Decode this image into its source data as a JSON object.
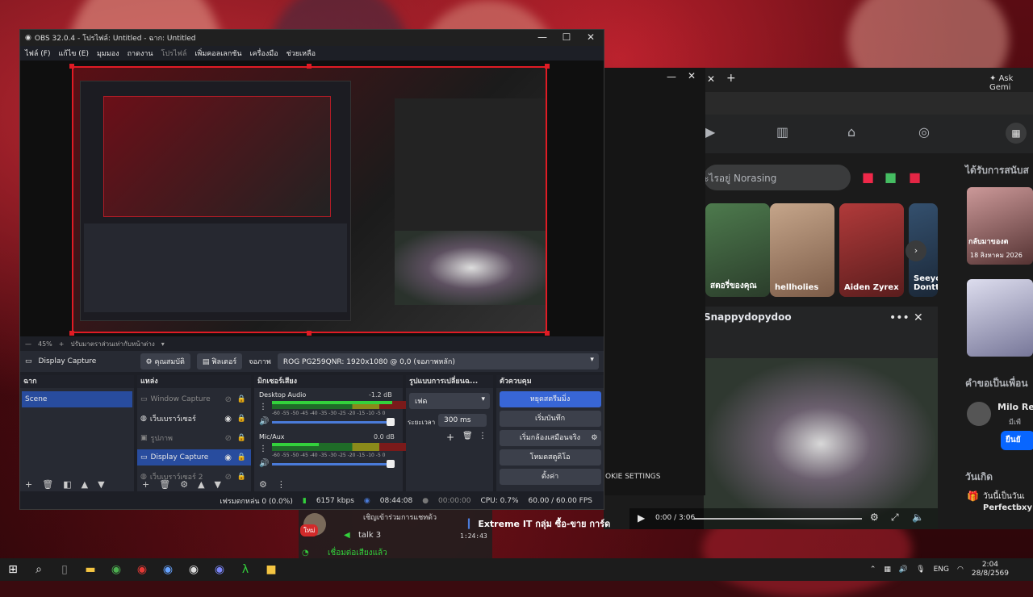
{
  "obs": {
    "title": "OBS 32.0.4 - โปรไฟล์: Untitled - ฉาก: Untitled",
    "menu": [
      "ไฟล์ (F)",
      "แก้ไข (E)",
      "มุมมอง",
      "ถาดงาน",
      "โปรไฟล์",
      "เพิ่มคอลเลกชัน",
      "เครื่องมือ",
      "ช่วยเหลือ"
    ],
    "zoom": "45%",
    "zoom_label": "ปรับมาตราส่วนเท่ากับหน้าต่าง",
    "source_name": "Display Capture",
    "properties_btn": "คุณสมบัติ",
    "filters_btn": "ฟิลเตอร์",
    "display_label": "จอภาพ",
    "display_value": "ROG PG259QNR: 1920x1080 @ 0,0 (จอภาพหลัก)",
    "scenes_header": "ฉาก",
    "scenes": [
      "Scene"
    ],
    "sources_header": "แหล่ง",
    "sources": [
      {
        "name": "Window Capture",
        "icon": "window-icon"
      },
      {
        "name": "เว็บเบราว์เซอร์",
        "icon": "globe-icon"
      },
      {
        "name": "รูปภาพ",
        "icon": "image-icon"
      },
      {
        "name": "Display Capture",
        "icon": "monitor-icon"
      },
      {
        "name": "เว็บเบราว์เซอร์ 2",
        "icon": "globe-icon"
      }
    ],
    "mixer_header": "มิกเซอร์เสียง",
    "mixer": [
      {
        "name": "Desktop Audio",
        "db": "-1.2 dB",
        "level": 0.9
      },
      {
        "name": "Mic/Aux",
        "db": "0.0 dB",
        "level": 0.35
      }
    ],
    "meter_ticks": "-60 -55 -50 -45 -40 -35 -30 -25 -20 -15 -10 -5 0",
    "transitions_header": "รูปแบบการเปลี่ยนฉ...",
    "transition_type": "เฟด",
    "duration_label": "ระยะเวลา",
    "duration_value": "300 ms",
    "controls_header": "ตัวควบคุม",
    "controls": [
      "หยุดสตรีมมิ่ง",
      "เริ่มบันทึก",
      "เริ่มกล้องเสมือนจริง",
      "โหมดสตูดิโอ",
      "ตั้งค่า"
    ],
    "status": {
      "dropped": "เฟรมตกหล่น 0 (0.0%)",
      "bitrate": "6157 kbps",
      "stream_time": "08:44:08",
      "rec_time": "00:00:00",
      "cpu": "CPU: 0.7%",
      "fps": "60.00 / 60.00 FPS"
    }
  },
  "browser": {
    "ask": "Ask Gemi",
    "search": "ะไรอยู่ Norasing",
    "stories": [
      "สตอรี่ของคุณ",
      "hellholies",
      "Aiden Zyrex",
      "Seeyo Dontt"
    ],
    "post_author": "Snappydopydoo",
    "video_time": "0:00 / 3:06",
    "cookie": "OKIE SETTINGS",
    "sidebar_title": "ได้รับการสนับส",
    "sidebar_date": "18 สิงหาคม 2026",
    "sidebar_banner": "กลับมาของต",
    "friend_req": "คำขอเป็นเพื่อน",
    "friend_name": "Milo Re",
    "friend_mutual": "มีเพื",
    "confirm": "ยืนยั",
    "birthday": "วันเกิด",
    "birthday_text": "วันนี้เป็นวันเ",
    "birthday_name": "Perfectbxy"
  },
  "chat": {
    "line1": "เชิญเข้าร่วมการแชทด้ว",
    "badge": "ใหม่",
    "talk": "talk 3",
    "time": "1:24:43",
    "voice": "เชื่อมต่อเสียงแล้ว",
    "extreme": "Extreme IT กลุ่ม ซื้อ-ขาย การ์ด"
  },
  "tray": {
    "lang": "ENG",
    "time": "2:04",
    "date": "28/8/2569"
  }
}
